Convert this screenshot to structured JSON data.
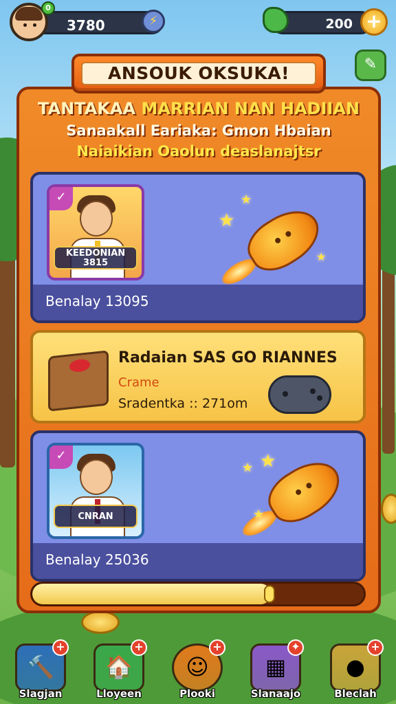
{
  "hud": {
    "left_value": "3780",
    "level_badge": "0",
    "right_value": "200",
    "energy_glyph": "⚡",
    "plus_glyph": "+"
  },
  "title": "ANSOUK OKSUKA!",
  "header": {
    "line1_part1": "TANTAKAA ",
    "line1_part2": "MARRIAN NAN HADIIAN",
    "line2": "Sanaakall Eariaka: Gmon Hbaian",
    "line3": "Naiaikian Oaolun deaslanajtsr"
  },
  "cards": [
    {
      "portrait_label_line1": "KEEDONIAN",
      "portrait_label_line2": "3815",
      "footer": "Benalay 13095"
    },
    {
      "portrait_label_line1": "CNRAN",
      "footer": "Benalay 25036"
    }
  ],
  "offer": {
    "title": "Radaian SAS GO RIANNES",
    "subtitle": "Crame",
    "detail": "Sradentka :: 271om"
  },
  "progress": {
    "value": 0.72
  },
  "nav": [
    {
      "label": "Slagjan",
      "icon": "hammer-icon",
      "color": "#2d6fb8"
    },
    {
      "label": "Lloyeen",
      "icon": "house-icon",
      "color": "#3aa84a"
    },
    {
      "label": "Plooki",
      "icon": "character-icon",
      "color": "#e07a1c"
    },
    {
      "label": "Slanaajo",
      "icon": "bread-icon",
      "color": "#8a58c8"
    },
    {
      "label": "Bleclah",
      "icon": "controller-icon",
      "color": "#c8a43a"
    }
  ],
  "colors": {
    "panel": "#e56c19",
    "panel_border": "#8a2e07",
    "card_blue": "#7f8ee6",
    "card_yellow": "#f6c346"
  }
}
